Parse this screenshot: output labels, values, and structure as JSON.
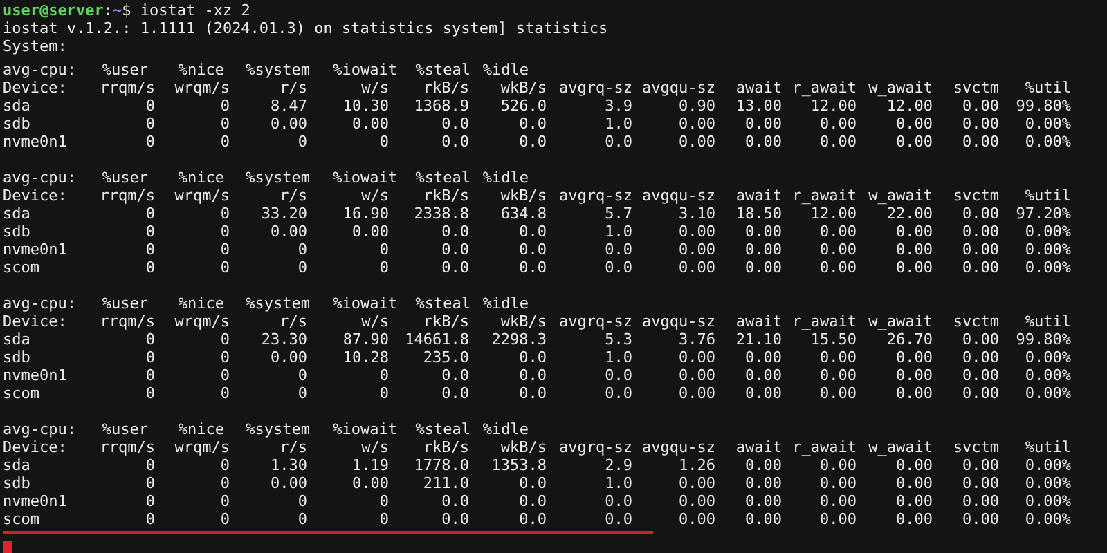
{
  "terminal": {
    "prompt": {
      "user_host": "user@server",
      "separator": ":",
      "path": "~",
      "symbol": "$",
      "command": "iostat -xz 2"
    },
    "output_lines": [
      "iostat v.1.2.: 1.1111 (2024.01.3) on statistics system] statistics",
      "System:"
    ],
    "reports": [
      {
        "cpu_header": [
          "avg-cpu:",
          "%user",
          "%nice",
          "%system",
          "%iowait",
          "%steal",
          "%idle"
        ],
        "device_header": [
          "Device:",
          "rrqm/s",
          "wrqm/s",
          "r/s",
          "w/s",
          "rkB/s",
          "wkB/s",
          "avgrq-sz",
          "avgqu-sz",
          "await",
          "r_await",
          "w_await",
          "svctm",
          "%util"
        ],
        "rows": [
          [
            "sda",
            "0",
            "0",
            "8.47",
            "10.30",
            "1368.9",
            "526.0",
            "3.9",
            "0.90",
            "13.00",
            "12.00",
            "12.00",
            "0.00",
            "99.80%"
          ],
          [
            "sdb",
            "0",
            "0",
            "0.00",
            "0.00",
            "0.0",
            "0.0",
            "1.0",
            "0.00",
            "0.00",
            "0.00",
            "0.00",
            "0.00",
            "0.00%"
          ],
          [
            "nvme0n1",
            "0",
            "0",
            "0",
            "0",
            "0.0",
            "0.0",
            "0.0",
            "0.00",
            "0.00",
            "0.00",
            "0.00",
            "0.00",
            "0.00%"
          ]
        ]
      },
      {
        "cpu_header": [
          "avg-cpu:",
          "%user",
          "%nice",
          "%system",
          "%iowait",
          "%steal",
          "%idle"
        ],
        "device_header": [
          "Device:",
          "rrqm/s",
          "wrqm/s",
          "r/s",
          "w/s",
          "rkB/s",
          "wkB/s",
          "avgrq-sz",
          "avgqu-sz",
          "await",
          "r_await",
          "w_await",
          "svctm",
          "%util"
        ],
        "rows": [
          [
            "sda",
            "0",
            "0",
            "33.20",
            "16.90",
            "2338.8",
            "634.8",
            "5.7",
            "3.10",
            "18.50",
            "12.00",
            "22.00",
            "0.00",
            "97.20%"
          ],
          [
            "sdb",
            "0",
            "0",
            "0.00",
            "0.00",
            "0.0",
            "0.0",
            "1.0",
            "0.00",
            "0.00",
            "0.00",
            "0.00",
            "0.00",
            "0.00%"
          ],
          [
            "nvme0n1",
            "0",
            "0",
            "0",
            "0",
            "0.0",
            "0.0",
            "0.0",
            "0.00",
            "0.00",
            "0.00",
            "0.00",
            "0.00",
            "0.00%"
          ],
          [
            "scom",
            "0",
            "0",
            "0",
            "0",
            "0.0",
            "0.0",
            "0.0",
            "0.00",
            "0.00",
            "0.00",
            "0.00",
            "0.00",
            "0.00%"
          ]
        ]
      },
      {
        "cpu_header": [
          "avg-cpu:",
          "%user",
          "%nice",
          "%system",
          "%iowait",
          "%steal",
          "%idle"
        ],
        "device_header": [
          "Device:",
          "rrqm/s",
          "wrqm/s",
          "r/s",
          "w/s",
          "rkB/s",
          "wkB/s",
          "avgrq-sz",
          "avgqu-sz",
          "await",
          "r_await",
          "w_await",
          "svctm",
          "%util"
        ],
        "rows": [
          [
            "sda",
            "0",
            "0",
            "23.30",
            "87.90",
            "14661.8",
            "2298.3",
            "5.3",
            "3.76",
            "21.10",
            "15.50",
            "26.70",
            "0.00",
            "99.80%"
          ],
          [
            "sdb",
            "0",
            "0",
            "0.00",
            "10.28",
            "235.0",
            "0.0",
            "1.0",
            "0.00",
            "0.00",
            "0.00",
            "0.00",
            "0.00",
            "0.00%"
          ],
          [
            "nvme0n1",
            "0",
            "0",
            "0",
            "0",
            "0.0",
            "0.0",
            "0.0",
            "0.00",
            "0.00",
            "0.00",
            "0.00",
            "0.00",
            "0.00%"
          ],
          [
            "scom",
            "0",
            "0",
            "0",
            "0",
            "0.0",
            "0.0",
            "0.0",
            "0.00",
            "0.00",
            "0.00",
            "0.00",
            "0.00",
            "0.00%"
          ]
        ]
      },
      {
        "cpu_header": [
          "avg-cpu:",
          "%user",
          "%nice",
          "%system",
          "%iowait",
          "%steal",
          "%idle"
        ],
        "device_header": [
          "Device:",
          "rrqm/s",
          "wrqm/s",
          "r/s",
          "w/s",
          "rkB/s",
          "wkB/s",
          "avgrq-sz",
          "avgqu-sz",
          "await",
          "r_await",
          "w_await",
          "svctm",
          "%util"
        ],
        "rows": [
          [
            "sda",
            "0",
            "0",
            "1.30",
            "1.19",
            "1778.0",
            "1353.8",
            "2.9",
            "1.26",
            "0.00",
            "0.00",
            "0.00",
            "0.00",
            "0.00%"
          ],
          [
            "sdb",
            "0",
            "0",
            "0.00",
            "0.00",
            "211.0",
            "0.0",
            "1.0",
            "0.00",
            "0.00",
            "0.00",
            "0.00",
            "0.00",
            "0.00%"
          ],
          [
            "nvme0n1",
            "0",
            "0",
            "0",
            "0",
            "0.0",
            "0.0",
            "0.0",
            "0.00",
            "0.00",
            "0.00",
            "0.00",
            "0.00",
            "0.00%"
          ],
          [
            "scom",
            "0",
            "0",
            "0",
            "0",
            "0.0",
            "0.0",
            "0.0",
            "0.00",
            "0.00",
            "0.00",
            "0.00",
            "0.00",
            "0.00%"
          ]
        ]
      }
    ]
  }
}
